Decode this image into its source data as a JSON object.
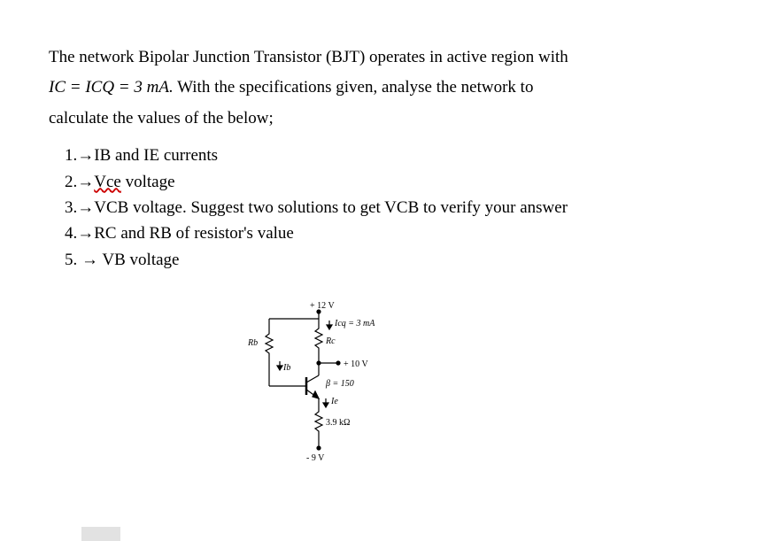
{
  "intro": {
    "line1": "The network Bipolar Junction Transistor (BJT) operates in active region with",
    "line2_eq": "IC = ICQ = 3 mA.",
    "line2_rest": " With the specifications given, analyse the network to",
    "line3": "calculate the values of the below;"
  },
  "items": {
    "n1": "1.→IB and IE currents",
    "n2a": "2.→",
    "n2b": "Vce",
    "n2c": " voltage",
    "n3": "3.→VCB voltage. Suggest two solutions to get VCB to verify your answer",
    "n4": "4.→RC and RB of resistor's value",
    "n5": "5. → VB voltage"
  },
  "circuit": {
    "top_supply": "+ 12 V",
    "icq": "Icq = 3 mA",
    "rc": "Rc",
    "rb": "Rb",
    "ib": "Ib",
    "collector_node": "+ 10 V",
    "beta": "β = 150",
    "ie": "Ie",
    "re_val": "3.9 kΩ",
    "neg_supply": "- 9 V"
  }
}
